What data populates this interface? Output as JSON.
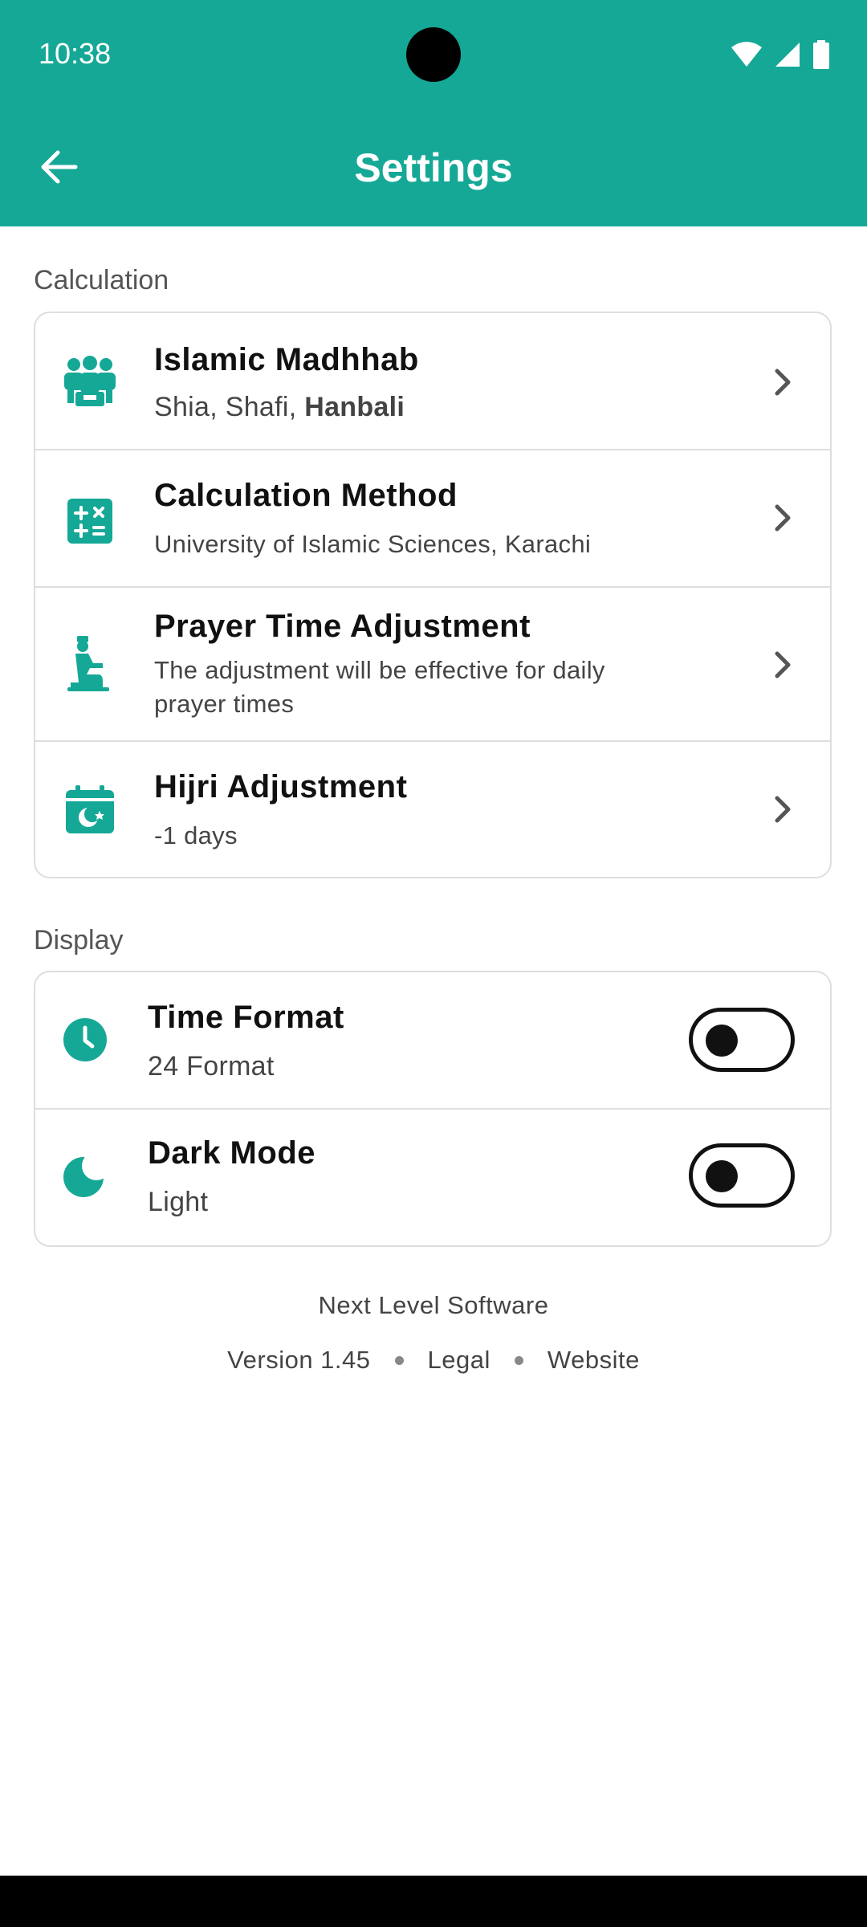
{
  "status_bar": {
    "time": "10:38"
  },
  "header": {
    "title": "Settings"
  },
  "sections": {
    "calculation": {
      "label": "Calculation",
      "items": [
        {
          "title": "Islamic Madhhab",
          "subtitle_plain": "Shia, Shafi, ",
          "subtitle_bold": "Hanbali",
          "icon": "people-group-icon"
        },
        {
          "title": "Calculation Method",
          "subtitle": "University of Islamic Sciences, Karachi",
          "icon": "calculator-icon"
        },
        {
          "title": "Prayer Time Adjustment",
          "subtitle_line1": "The adjustment will be effective for daily",
          "subtitle_line2": "prayer times",
          "icon": "praying-person-icon"
        },
        {
          "title": "Hijri Adjustment",
          "subtitle": "-1 days",
          "icon": "calendar-crescent-icon"
        }
      ]
    },
    "display": {
      "label": "Display",
      "items": [
        {
          "title": "Time Format",
          "subtitle": "24 Format",
          "toggle_on": false,
          "icon": "clock-icon"
        },
        {
          "title": "Dark Mode",
          "subtitle": "Light",
          "toggle_on": false,
          "icon": "moon-icon"
        }
      ]
    }
  },
  "footer": {
    "company": "Next Level Software",
    "version": "Version 1.45",
    "legal": "Legal",
    "website": "Website"
  },
  "colors": {
    "accent": "#15a896",
    "text": "#111111",
    "muted": "#444444",
    "border": "#dedede"
  }
}
